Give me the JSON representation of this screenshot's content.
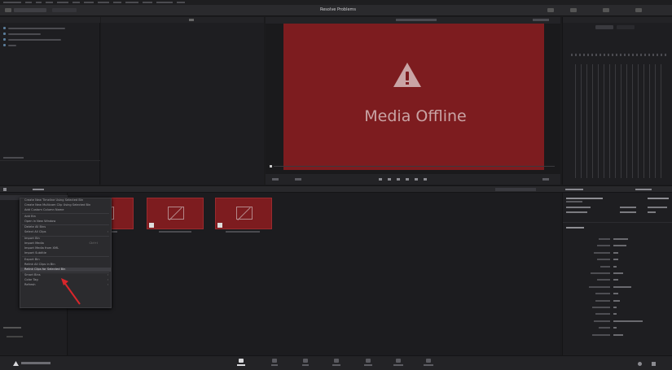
{
  "app": {
    "title": "Resolve Problems",
    "viewer_message": "Media Offline",
    "brand": "DaVinci Resolve 18"
  },
  "colors": {
    "offline_red": "#7d1c1f",
    "offline_text": "#c9a4a5",
    "annotation_arrow": "#d8262b"
  },
  "context_menu": {
    "items": [
      {
        "label": "Create New Timeline Using Selected Bin",
        "type": "item"
      },
      {
        "label": "Create New Multicam Clip Using Selected Bin",
        "type": "item"
      },
      {
        "label": "Add Custom Column Name",
        "type": "item"
      },
      {
        "type": "sep"
      },
      {
        "label": "Add Bin",
        "type": "item"
      },
      {
        "label": "Open in New Window",
        "type": "item"
      },
      {
        "type": "sep"
      },
      {
        "label": "Delete All Bins",
        "type": "item"
      },
      {
        "label": "Select All Clips",
        "type": "item",
        "arrow": true
      },
      {
        "type": "sep"
      },
      {
        "label": "Import Bin",
        "type": "item"
      },
      {
        "label": "Import Media",
        "type": "item",
        "shortcut": "Ctrl+I"
      },
      {
        "label": "Import Media from XML",
        "type": "item"
      },
      {
        "label": "Import Subtitle",
        "type": "item"
      },
      {
        "type": "sep"
      },
      {
        "label": "Export Bin",
        "type": "item"
      },
      {
        "label": "Relink All Clips in Bin",
        "type": "item"
      },
      {
        "label": "Relink Clips for Selected Bin",
        "type": "item",
        "highlight": true
      },
      {
        "type": "sep"
      },
      {
        "label": "Smart Bins",
        "type": "item",
        "arrow": true
      },
      {
        "label": "Color Tag",
        "type": "item",
        "arrow": true
      },
      {
        "label": "Refresh",
        "type": "item",
        "arrow": true
      }
    ]
  }
}
